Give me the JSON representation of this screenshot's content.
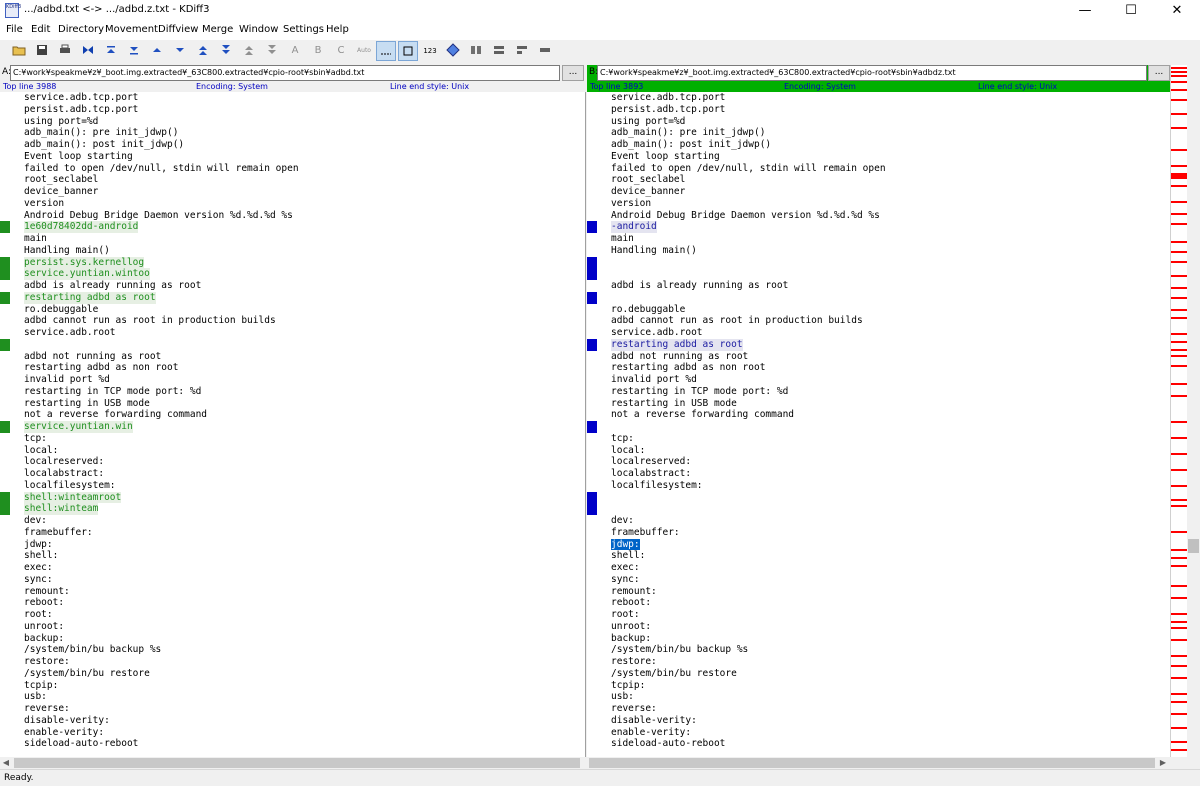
{
  "window": {
    "title": ".../adbd.txt <-> .../adbd.z.txt - KDiff3",
    "app_icon_text": "KDiff3",
    "minimize": "—",
    "maximize": "☐",
    "close": "✕"
  },
  "menu": [
    "File",
    "Edit",
    "Directory",
    "Movement",
    "Diffview",
    "Merge",
    "Window",
    "Settings",
    "Help"
  ],
  "toolbar_icons": [
    "open-folder-icon",
    "save-icon",
    "print-icon",
    "run-merge-icon",
    "go-top-icon",
    "go-bottom-icon",
    "go-prev-delta-icon",
    "go-next-delta-icon",
    "go-prev-conflict-icon",
    "go-next-conflict-icon",
    "go-prev-unsolved-icon",
    "go-next-unsolved-icon",
    "select-a-icon",
    "select-b-icon",
    "select-c-icon",
    "auto-advance-icon",
    "show-whitespace-icon",
    "show-whitespace-chars-icon",
    "show-line-numbers-icon",
    "choose-a-everywhere-icon",
    "window-split-icon",
    "overview-a-b-icon",
    "overview-a-c-icon",
    "overview-b-c-icon",
    "word-wrap-icon"
  ],
  "toolbar_text": {
    "a": "A",
    "b": "B",
    "c": "C",
    "auto": "Auto",
    "nums": "123"
  },
  "paneA": {
    "label": "A:",
    "path": "C:¥work¥speakme¥z¥_boot.img.extracted¥_63C800.extracted¥cpio-root¥sbin¥adbd.txt",
    "browse": "...",
    "top_line": "Top line 3988",
    "encoding": "Encoding: System",
    "line_end": "Line end style: Unix",
    "accent": "#1f8f1f"
  },
  "paneB": {
    "label": "B:",
    "path": "C:¥work¥speakme¥z¥_boot.img.extracted¥_63C800.extracted¥cpio-root¥sbin¥adbdz.txt",
    "browse": "...",
    "top_line": "Top line 3893",
    "encoding": "Encoding: System",
    "line_end": "Line end style: Unix",
    "accent": "#0000c8"
  },
  "linesA": [
    {
      "t": "service.adb.tcp.port",
      "s": ""
    },
    {
      "t": "persist.adb.tcp.port",
      "s": ""
    },
    {
      "t": "using port=%d",
      "s": ""
    },
    {
      "t": "adb_main(): pre init_jdwp()",
      "s": ""
    },
    {
      "t": "adb_main(): post init_jdwp()",
      "s": ""
    },
    {
      "t": "Event loop starting",
      "s": ""
    },
    {
      "t": "failed to open /dev/null, stdin will remain open",
      "s": ""
    },
    {
      "t": "root_seclabel",
      "s": ""
    },
    {
      "t": "device_banner",
      "s": ""
    },
    {
      "t": "version",
      "s": ""
    },
    {
      "t": "Android Debug Bridge Daemon version %d.%d.%d %s",
      "s": ""
    },
    {
      "t": "1e60d78402dd-android",
      "s": "chg"
    },
    {
      "t": "main",
      "s": ""
    },
    {
      "t": "Handling main()",
      "s": ""
    },
    {
      "t": "persist.sys.kernellog",
      "s": "chg"
    },
    {
      "t": "service.yuntian.wintoo",
      "s": "chg"
    },
    {
      "t": "adbd is already running as root",
      "s": ""
    },
    {
      "t": "restarting adbd as root",
      "s": "chg"
    },
    {
      "t": "ro.debuggable",
      "s": ""
    },
    {
      "t": "adbd cannot run as root in production builds",
      "s": ""
    },
    {
      "t": "service.adb.root",
      "s": ""
    },
    {
      "t": "",
      "s": ""
    },
    {
      "t": "adbd not running as root",
      "s": ""
    },
    {
      "t": "restarting adbd as non root",
      "s": ""
    },
    {
      "t": "invalid port %d",
      "s": ""
    },
    {
      "t": "restarting in TCP mode port: %d",
      "s": ""
    },
    {
      "t": "restarting in USB mode",
      "s": ""
    },
    {
      "t": "not a reverse forwarding command",
      "s": ""
    },
    {
      "t": "service.yuntian.win",
      "s": "chg"
    },
    {
      "t": "tcp:",
      "s": ""
    },
    {
      "t": "local:",
      "s": ""
    },
    {
      "t": "localreserved:",
      "s": ""
    },
    {
      "t": "localabstract:",
      "s": ""
    },
    {
      "t": "localfilesystem:",
      "s": ""
    },
    {
      "t": "shell:winteamroot",
      "s": "chg"
    },
    {
      "t": "shell:winteam",
      "s": "chg"
    },
    {
      "t": "dev:",
      "s": ""
    },
    {
      "t": "framebuffer:",
      "s": ""
    },
    {
      "t": "jdwp:",
      "s": ""
    },
    {
      "t": "shell:",
      "s": ""
    },
    {
      "t": "exec:",
      "s": ""
    },
    {
      "t": "sync:",
      "s": ""
    },
    {
      "t": "remount:",
      "s": ""
    },
    {
      "t": "reboot:",
      "s": ""
    },
    {
      "t": "root:",
      "s": ""
    },
    {
      "t": "unroot:",
      "s": ""
    },
    {
      "t": "backup:",
      "s": ""
    },
    {
      "t": "/system/bin/bu backup %s",
      "s": ""
    },
    {
      "t": "restore:",
      "s": ""
    },
    {
      "t": "/system/bin/bu restore",
      "s": ""
    },
    {
      "t": "tcpip:",
      "s": ""
    },
    {
      "t": "usb:",
      "s": ""
    },
    {
      "t": "reverse:",
      "s": ""
    },
    {
      "t": "disable-verity:",
      "s": ""
    },
    {
      "t": "enable-verity:",
      "s": ""
    },
    {
      "t": "sideload-auto-reboot",
      "s": ""
    }
  ],
  "linesB": [
    {
      "t": "service.adb.tcp.port",
      "s": ""
    },
    {
      "t": "persist.adb.tcp.port",
      "s": ""
    },
    {
      "t": "using port=%d",
      "s": ""
    },
    {
      "t": "adb_main(): pre init_jdwp()",
      "s": ""
    },
    {
      "t": "adb_main(): post init_jdwp()",
      "s": ""
    },
    {
      "t": "Event loop starting",
      "s": ""
    },
    {
      "t": "failed to open /dev/null, stdin will remain open",
      "s": ""
    },
    {
      "t": "root_seclabel",
      "s": ""
    },
    {
      "t": "device_banner",
      "s": ""
    },
    {
      "t": "version",
      "s": ""
    },
    {
      "t": "Android Debug Bridge Daemon version %d.%d.%d %s",
      "s": ""
    },
    {
      "t": "-android",
      "s": "chg"
    },
    {
      "t": "main",
      "s": ""
    },
    {
      "t": "Handling main()",
      "s": ""
    },
    {
      "t": "",
      "s": ""
    },
    {
      "t": "",
      "s": ""
    },
    {
      "t": "adbd is already running as root",
      "s": ""
    },
    {
      "t": "",
      "s": ""
    },
    {
      "t": "ro.debuggable",
      "s": ""
    },
    {
      "t": "adbd cannot run as root in production builds",
      "s": ""
    },
    {
      "t": "service.adb.root",
      "s": ""
    },
    {
      "t": "restarting adbd as root",
      "s": "chg"
    },
    {
      "t": "adbd not running as root",
      "s": ""
    },
    {
      "t": "restarting adbd as non root",
      "s": ""
    },
    {
      "t": "invalid port %d",
      "s": ""
    },
    {
      "t": "restarting in TCP mode port: %d",
      "s": ""
    },
    {
      "t": "restarting in USB mode",
      "s": ""
    },
    {
      "t": "not a reverse forwarding command",
      "s": ""
    },
    {
      "t": "",
      "s": ""
    },
    {
      "t": "tcp:",
      "s": ""
    },
    {
      "t": "local:",
      "s": ""
    },
    {
      "t": "localreserved:",
      "s": ""
    },
    {
      "t": "localabstract:",
      "s": ""
    },
    {
      "t": "localfilesystem:",
      "s": ""
    },
    {
      "t": "",
      "s": ""
    },
    {
      "t": "",
      "s": ""
    },
    {
      "t": "dev:",
      "s": ""
    },
    {
      "t": "framebuffer:",
      "s": ""
    },
    {
      "t": "jdwp:",
      "s": "sel"
    },
    {
      "t": "shell:",
      "s": ""
    },
    {
      "t": "exec:",
      "s": ""
    },
    {
      "t": "sync:",
      "s": ""
    },
    {
      "t": "remount:",
      "s": ""
    },
    {
      "t": "reboot:",
      "s": ""
    },
    {
      "t": "root:",
      "s": ""
    },
    {
      "t": "unroot:",
      "s": ""
    },
    {
      "t": "backup:",
      "s": ""
    },
    {
      "t": "/system/bin/bu backup %s",
      "s": ""
    },
    {
      "t": "restore:",
      "s": ""
    },
    {
      "t": "/system/bin/bu restore",
      "s": ""
    },
    {
      "t": "tcpip:",
      "s": ""
    },
    {
      "t": "usb:",
      "s": ""
    },
    {
      "t": "reverse:",
      "s": ""
    },
    {
      "t": "disable-verity:",
      "s": ""
    },
    {
      "t": "enable-verity:",
      "s": ""
    },
    {
      "t": "sideload-auto-reboot",
      "s": ""
    }
  ],
  "overview_color": "#ff0000",
  "status": "Ready."
}
